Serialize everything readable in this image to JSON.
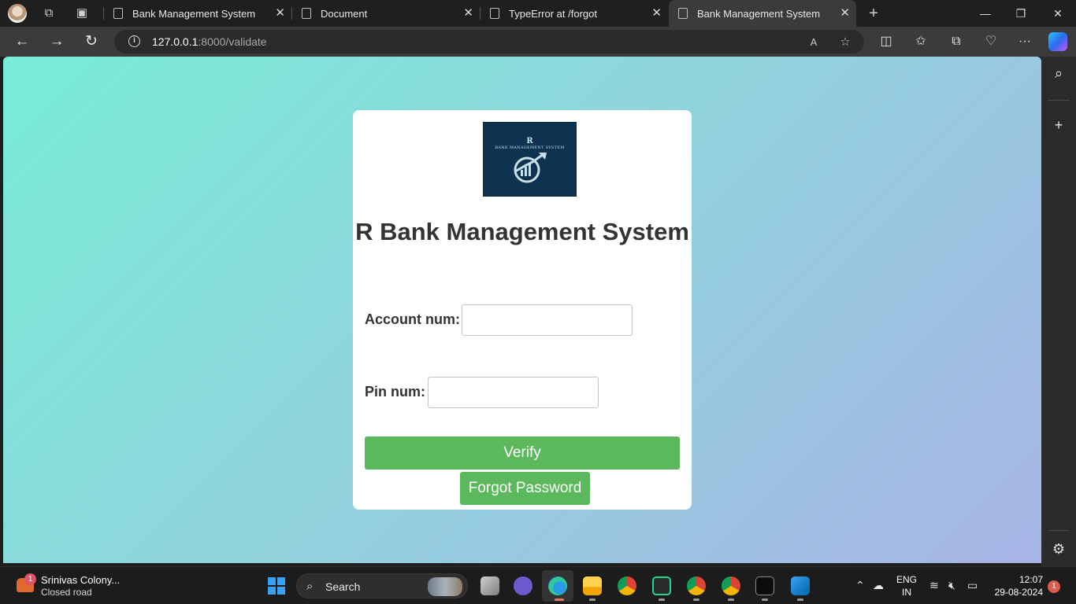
{
  "browser": {
    "tabs": [
      {
        "label": "Bank Management System"
      },
      {
        "label": "Document"
      },
      {
        "label": "TypeError at /forgot"
      },
      {
        "label": "Bank Management System"
      }
    ],
    "address": {
      "host": "127.0.0.1",
      "rest": ":8000/validate"
    }
  },
  "page": {
    "logo": {
      "letter": "R",
      "subtitle": "BANK MANAGEMENT SYSTEM"
    },
    "title": "R Bank Management System",
    "form": {
      "account_label": "Account num:",
      "account_value": "",
      "pin_label": "Pin num:",
      "pin_value": "",
      "verify_label": "Verify",
      "forgot_label": "Forgot Password"
    },
    "colors": {
      "button": "#5cb85c",
      "gradient_start": "#77ecd6",
      "gradient_end": "#a8b4e6",
      "logo_bg": "#0e3350"
    }
  },
  "taskbar": {
    "weather": {
      "badge": "1",
      "title": "Srinivas Colony...",
      "status": "Closed road"
    },
    "search_label": "Search",
    "tray": {
      "lang1": "ENG",
      "lang2": "IN",
      "time": "12:07",
      "date": "29-08-2024",
      "notifications": "1"
    }
  }
}
